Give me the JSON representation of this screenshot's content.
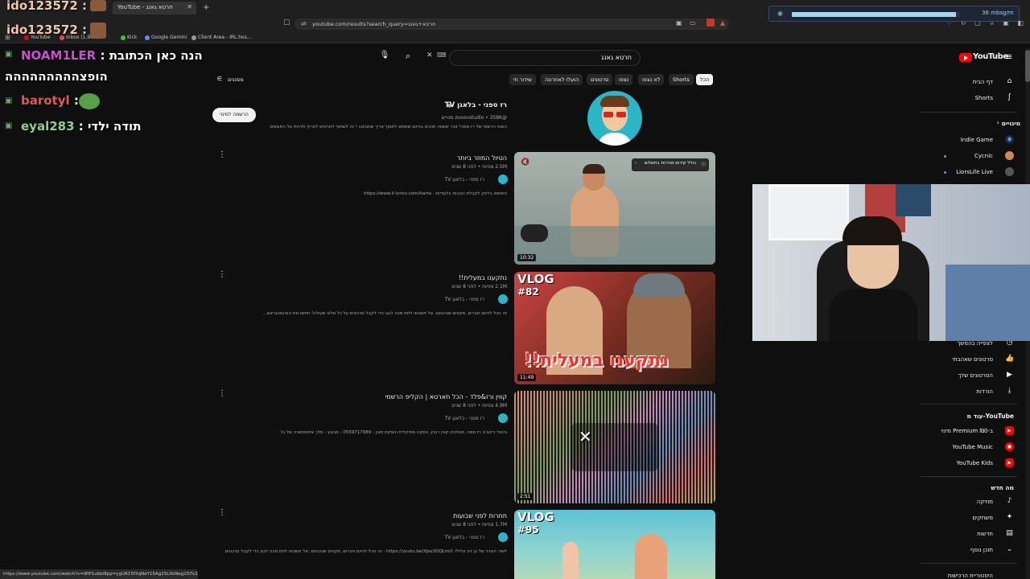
{
  "browser": {
    "tab_title": "YouTube - חרטא גאנג",
    "url": "youtube.com/results?search_query=חרטא+גאנג",
    "bookmarks": [
      "YouTube",
      "Inbox (1,980)",
      "Kick",
      "Google Gemini",
      "Client Area - IRL.hos..."
    ],
    "status_url": "https://www.youtube.com/watch?v=i8IP1ubbl8pp=ygUR15fXqNeY15Ag15LXkNeg15I%3D"
  },
  "overlay": {
    "user1": "ido123572 :",
    "user2": "ido123572 :",
    "chat": [
      {
        "name": "NOAM1LER",
        "sep": " : ",
        "msg": "הנה כאן הכתובת",
        "msg2": "הופצההההההההה",
        "color": "#d04bd6"
      },
      {
        "name": "barotyl",
        "sep": " : ",
        "msg": "",
        "color": "#e05a4e"
      },
      {
        "name": "eyal283",
        "sep": " : ",
        "msg": "תודה ילדי",
        "color": "#8fd08f"
      }
    ],
    "bitrate": "36 mbsg/m"
  },
  "youtube": {
    "logo": "YouTube",
    "search_value": "חרטא גאנג",
    "filters_label": "מסננים",
    "chips": [
      "הכל",
      "Shorts",
      "לא נצפו",
      "נצפו",
      "סרטונים",
      "הועלו לאחרונה",
      "שידור חי"
    ],
    "sidebar": {
      "home": "דף הבית",
      "shorts": "Shorts",
      "subs_head": "מינויים",
      "subs": [
        "Indie Game",
        "Cycnic",
        "LiorsLife Live"
      ],
      "you_items": [
        "לצפייה בהמשך",
        "סרטונים שאהבתי",
        "הסרטונים שלך",
        "הורדות"
      ],
      "more_head": "עוד מ-YouTube",
      "more_items": [
        "מינוי Premium ב-₪0",
        "YouTube Music",
        "YouTube Kids"
      ],
      "explore_head": "מה חדש",
      "explore_items": [
        "מוזיקה",
        "משחקים",
        "חדשות",
        "תוכן נוסף"
      ],
      "footer": "היסטוריית הרכישות"
    },
    "channel": {
      "name": "רז ספני - בלאגן TV",
      "handle": "@zvoovstudio • 358K מנויים",
      "desc": "המנוי הרשמי של רז ספני! זוכר ששווה תכנים בחינם שממש לתמוך צריך שתכתבו ! זה לשתוף לחרטים לערוץ ולהיות על המעשים",
      "subscribe": "הרשמה למינוי"
    },
    "videos": [
      {
        "title": "הטיול המוזר ביותר",
        "meta": "2.5M צפיות • לפני 8 שנים",
        "channel": "רז ספני - בלאגן TV",
        "desc": "השתמו בלינק לקבלת הטבות בלעדיות - https://www.li-lyrics.com/harta",
        "duration": "10:32",
        "ad": "כולל קידום מכירות בתשלום"
      },
      {
        "title": "נתקענו במעלית!!",
        "meta": "2.1M צפיות • לפני 8 שנים",
        "channel": "רז ספני - בלאגן TV",
        "desc": "זה הכל להיום חברים, מקווים שנהנתם. אל תשכחו לתת מכה לגגג כדי לקבל עדכונים על כל אלא שעולה! חפשו את האינסטגראם...",
        "duration": "11:49",
        "thumb_text": "נתקענו במעלית!!",
        "vlog": "VLOG",
        "vlog_num": "#82"
      },
      {
        "title": "קווין ורז&פלד - הכל חארטא | הקליפ הרשמי",
        "meta": "4.9M צפיות • לפני 8 שנים",
        "channel": "רז ספני - בלאגן TV",
        "desc": "ביטול ריינצ'ה רז ספני, מאלכוין קווין רובין, הפקה מוזיקלית והפקת תוכן - 0559717989 - מבצע - מלך איפוסמציה של נו!",
        "duration": "2:51"
      },
      {
        "title": "תחרות לפני שבועות",
        "meta": "1.7M צפיות • לפני 8 שנים",
        "channel": "רז ספני - בלאגן TV",
        "desc": "לשיר הנודד של בן זיני וגלילי: https://youtu.be/XJez3DQLmU - זה הכל להיום חברים, מקווים שנהנתם. אל תשכחו לתת מכה לגגג כדי לקבל עדכונים",
        "vlog": "VLOG",
        "vlog_num": "#95"
      }
    ]
  }
}
